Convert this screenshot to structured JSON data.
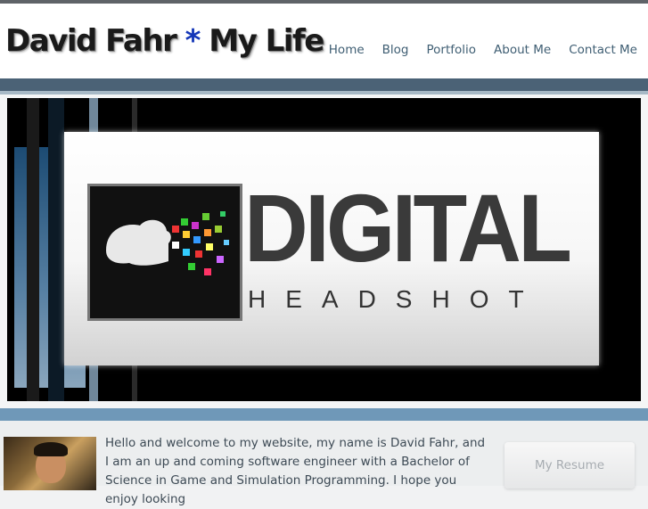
{
  "header": {
    "title_part1": "David Fahr",
    "title_star": "*",
    "title_part2": "My Life",
    "nav": [
      "Home",
      "Blog",
      "Portfolio",
      "About Me",
      "Contact Me"
    ]
  },
  "slider": {
    "logo_word": "DIGITAL",
    "logo_sub": "HEADSHOT"
  },
  "content": {
    "intro": "Hello and welcome to my website, my name is David Fahr, and I am an up and coming software engineer with a Bachelor of Science in Game and Simulation Programming. I hope you enjoy looking",
    "resume_label": "My Resume"
  },
  "colors": {
    "accent_dark": "#4b6276",
    "accent_light": "#6f98b8",
    "title_star": "#1537b8",
    "nav_text": "#3f5e73"
  }
}
